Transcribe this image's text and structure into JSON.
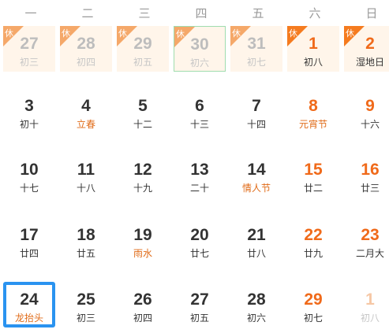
{
  "weekdays": [
    "一",
    "二",
    "三",
    "四",
    "五",
    "六",
    "日"
  ],
  "holiday_badge": "休",
  "rows": [
    [
      {
        "day": "27",
        "lunar": "初三",
        "other": true,
        "off": true
      },
      {
        "day": "28",
        "lunar": "初四",
        "other": true,
        "off": true
      },
      {
        "day": "29",
        "lunar": "初五",
        "other": true,
        "off": true
      },
      {
        "day": "30",
        "lunar": "初六",
        "other": true,
        "off": true,
        "outline": true
      },
      {
        "day": "31",
        "lunar": "初七",
        "other": true,
        "off": true
      },
      {
        "day": "1",
        "lunar": "初八",
        "off": true,
        "weekend": true
      },
      {
        "day": "2",
        "lunar": "湿地日",
        "off": true,
        "weekend": true
      }
    ],
    [
      {
        "day": "3",
        "lunar": "初十"
      },
      {
        "day": "4",
        "lunar": "立春",
        "fest": true
      },
      {
        "day": "5",
        "lunar": "十二"
      },
      {
        "day": "6",
        "lunar": "十三"
      },
      {
        "day": "7",
        "lunar": "十四"
      },
      {
        "day": "8",
        "lunar": "元宵节",
        "weekend": true,
        "fest": true
      },
      {
        "day": "9",
        "lunar": "十六",
        "weekend": true
      }
    ],
    [
      {
        "day": "10",
        "lunar": "十七"
      },
      {
        "day": "11",
        "lunar": "十八"
      },
      {
        "day": "12",
        "lunar": "十九"
      },
      {
        "day": "13",
        "lunar": "二十"
      },
      {
        "day": "14",
        "lunar": "情人节",
        "fest": true
      },
      {
        "day": "15",
        "lunar": "廿二",
        "weekend": true
      },
      {
        "day": "16",
        "lunar": "廿三",
        "weekend": true
      }
    ],
    [
      {
        "day": "17",
        "lunar": "廿四"
      },
      {
        "day": "18",
        "lunar": "廿五"
      },
      {
        "day": "19",
        "lunar": "雨水",
        "fest": true
      },
      {
        "day": "20",
        "lunar": "廿七"
      },
      {
        "day": "21",
        "lunar": "廿八"
      },
      {
        "day": "22",
        "lunar": "廿九",
        "weekend": true
      },
      {
        "day": "23",
        "lunar": "二月大",
        "weekend": true
      }
    ],
    [
      {
        "day": "24",
        "lunar": "龙抬头",
        "selected": true,
        "fest": true
      },
      {
        "day": "25",
        "lunar": "初三"
      },
      {
        "day": "26",
        "lunar": "初四"
      },
      {
        "day": "27",
        "lunar": "初五"
      },
      {
        "day": "28",
        "lunar": "初六"
      },
      {
        "day": "29",
        "lunar": "初七",
        "weekend": true
      },
      {
        "day": "1",
        "lunar": "初八",
        "weekend": true,
        "other": true
      }
    ]
  ]
}
